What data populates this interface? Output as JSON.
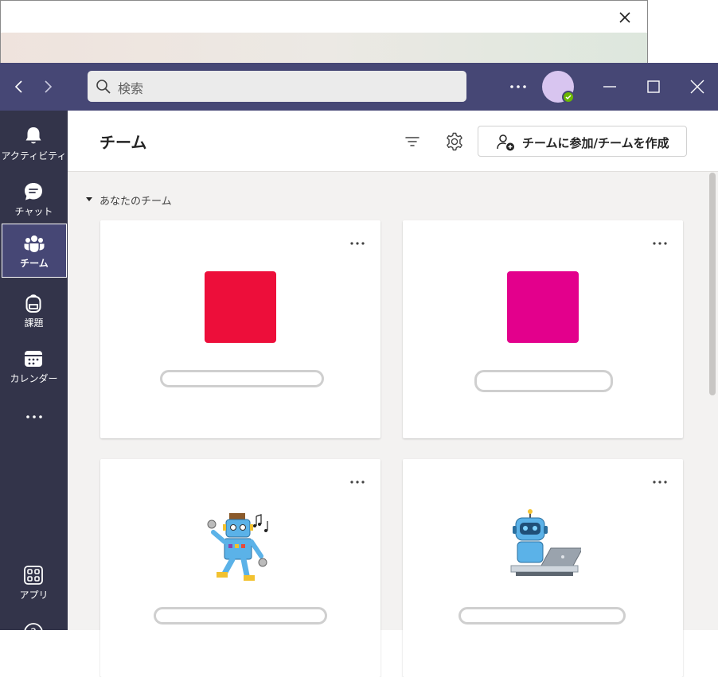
{
  "search": {
    "placeholder": "検索"
  },
  "rail": {
    "items": [
      {
        "label": "アクティビティ",
        "icon": "bell-icon"
      },
      {
        "label": "チャット",
        "icon": "chat-icon"
      },
      {
        "label": "チーム",
        "icon": "teams-icon",
        "active": true
      },
      {
        "label": "課題",
        "icon": "backpack-icon"
      },
      {
        "label": "カレンダー",
        "icon": "calendar-icon"
      }
    ],
    "apps_label": "アプリ",
    "help_label": "?"
  },
  "header": {
    "title": "チーム",
    "join_button_label": "チームに参加/チームを作成"
  },
  "section": {
    "label": "あなたのチーム"
  },
  "teams": [
    {
      "tile_color": "#ed0e3a",
      "kind": "color"
    },
    {
      "tile_color": "#e3008c",
      "kind": "color"
    },
    {
      "kind": "robot-music"
    },
    {
      "kind": "robot-laptop"
    }
  ],
  "colors": {
    "titlebar": "#464775",
    "rail": "#33344a",
    "main_bg": "#f3f2f1",
    "presence": "#6bb700"
  }
}
